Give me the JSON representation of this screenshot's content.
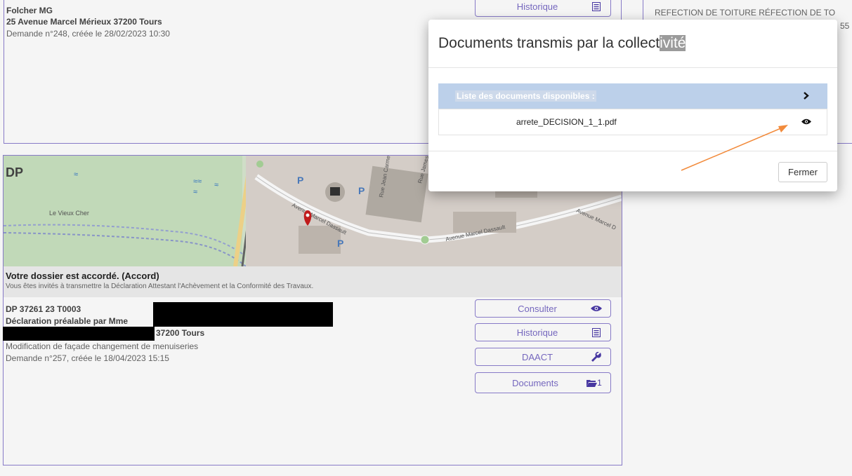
{
  "top_card": {
    "name": "Folcher MG",
    "address": "25 Avenue Marcel Mérieux 37200 Tours",
    "request": "Demande n°248, créée le 28/02/2023 10:30",
    "history_label": "Historique"
  },
  "right_card": {
    "title": "REFECTION DE TOITURE RÉFECTION DE TO",
    "fragment": "55"
  },
  "dossier": {
    "map_label": "DP",
    "map_places": [
      "Le Vieux Cher",
      "Avenue Marcel Dassault",
      "Avenue Marcel Dassault",
      "Rue Jean Carmet",
      "Rue James Watt",
      "Avenue Marcel D"
    ],
    "status_title": "Votre dossier est accordé. (Accord)",
    "status_text": "Vous êtes invités à transmettre la Déclaration Attestant l'Achèvement et la Conformité des Travaux.",
    "reference": "DP 37261 23 T0003",
    "type_line": "Déclaration préalable par Mme",
    "city_line": "37200 Tours",
    "description": "Modification de façade changement de menuiseries",
    "request": "Demande n°257, créée le 18/04/2023 15:15",
    "buttons": {
      "consult": "Consulter",
      "history": "Historique",
      "daact": "DAACT",
      "documents": "Documents",
      "documents_count": "1"
    }
  },
  "modal": {
    "title_main": "Documents transmis par la collect",
    "title_highlight": "ivité",
    "list_header": "Liste des documents disponibles :",
    "file_name": "arrete_DECISION_1_1.pdf",
    "close_label": "Fermer"
  },
  "colors": {
    "card_border": "#8d7fd0",
    "button_text": "#7a6cc6",
    "list_header_bg": "#bcd0ea",
    "annotation_arrow": "#f28b3c"
  },
  "icons": {
    "history": "list-icon",
    "consult": "eye-icon",
    "daact": "wrench-icon",
    "documents": "folder-icon",
    "list_expand": "chevron-right-icon",
    "file_view": "eye-icon",
    "map_marker": "map-marker-icon"
  }
}
